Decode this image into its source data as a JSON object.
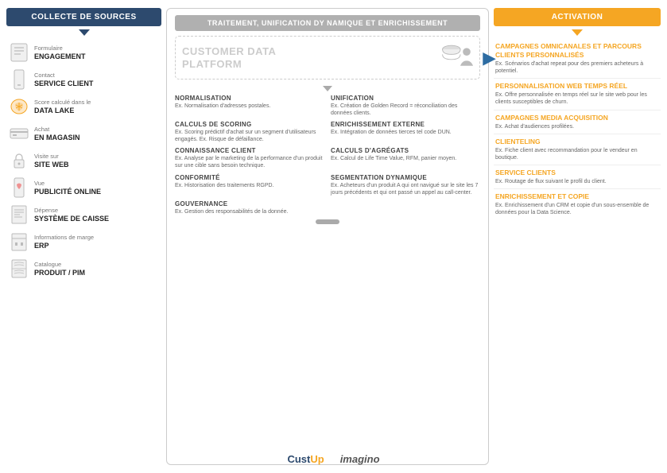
{
  "left": {
    "header": "COLLECTE DE SOURCES",
    "sources": [
      {
        "id": "engagement",
        "label": "Formulaire",
        "bold": "ENGAGEMENT",
        "icon": "form"
      },
      {
        "id": "service-client",
        "label": "Contact",
        "bold": "SERVICE CLIENT",
        "icon": "phone"
      },
      {
        "id": "data-lake",
        "label": "Score calculé dans le",
        "bold": "DATA LAKE",
        "icon": "brain"
      },
      {
        "id": "magasin",
        "label": "Achat",
        "bold": "EN MAGASIN",
        "icon": "card"
      },
      {
        "id": "site-web",
        "label": "Visite sur",
        "bold": "SITE WEB",
        "icon": "lock"
      },
      {
        "id": "publicite",
        "label": "Vue",
        "bold": "PUBLICITÉ ONLINE",
        "icon": "heart"
      },
      {
        "id": "caisse",
        "label": "Dépense",
        "bold": "SYSTÈME DE CAISSE",
        "icon": "receipt"
      },
      {
        "id": "erp",
        "label": "Informations de marge",
        "bold": "ERP",
        "icon": "building"
      },
      {
        "id": "pim",
        "label": "Catalogue",
        "bold": "PRODUIT / PIM",
        "icon": "book"
      }
    ]
  },
  "middle": {
    "header": "TRAITEMENT, UNIFICATION DY NAMIQUE ET ENRICHISSEMENT",
    "cdp_title": "CUSTOMER DATA\nPLATFORM",
    "items": [
      {
        "id": "normalisation",
        "title": "NORMALISATION",
        "desc": "Ex. Normalisation d'adresses postales."
      },
      {
        "id": "unification",
        "title": "UNIFICATION",
        "desc": "Ex. Création de Golden Record = réconciliation des données clients."
      },
      {
        "id": "calculs-scoring",
        "title": "CALCULS DE SCORING",
        "desc": "Ex. Scoring prédictif d'achat sur un segment d'utilisateurs engagés. Ex. Risque de défaillance."
      },
      {
        "id": "enrichissement-externe",
        "title": "ENRICHISSEMENT EXTERNE",
        "desc": "Ex. Intégration de données tierces tel code DUN."
      },
      {
        "id": "connaissance-client",
        "title": "CONNAISSANCE CLIENT",
        "desc": "Ex. Analyse par le marketing de la performance d'un produit sur une cible sans besoin technique."
      },
      {
        "id": "calculs-agregats",
        "title": "CALCULS D'AGRÉGATS",
        "desc": "Ex. Calcul de Life Time Value, RFM, panier moyen."
      },
      {
        "id": "conformite",
        "title": "CONFORMITÉ",
        "desc": "Ex. Historisation des traitements RGPD."
      },
      {
        "id": "segmentation",
        "title": "SEGMENTATION DYNAMIQUE",
        "desc": "Ex. Acheteurs d'un produit A qui ont navigué sur le site les 7 jours précédents et qui ont passé un appel au call-center."
      },
      {
        "id": "gouvernance",
        "title": "GOUVERNANCE",
        "desc": "Ex. Gestion des responsabilités de la donnée."
      }
    ]
  },
  "right": {
    "header": "ActivaTION",
    "items": [
      {
        "id": "campagnes-omnicanales",
        "title": "CAMPAGNES OMNICANALES ET PARCOURS CLIENTS PERSONNALISÉS",
        "desc": "Ex. Scénarios d'achat repeat pour des premiers acheteurs à potentiel."
      },
      {
        "id": "personnalisation-web",
        "title": "PERSONNALISATION WEB TEMPS RÉEL",
        "desc": "Ex. Offre personnalisée en temps réel sur le site web pour les clients susceptibles de churn."
      },
      {
        "id": "campagnes-media",
        "title": "CAMPAGNES MEDIA ACQUISITION",
        "desc": "Ex. Achat d'audiences profilées."
      },
      {
        "id": "clienteling",
        "title": "CLIENTELING",
        "desc": "Ex. Fiche client avec recommandation pour le vendeur en boutique."
      },
      {
        "id": "service-clients",
        "title": "SERVICE CLIENTS",
        "desc": "Ex. Routage de flux suivant le profil du client."
      },
      {
        "id": "enrichissement-copie",
        "title": "ENRICHISSEMENT ET COPIE",
        "desc": "Ex. Enrichissement d'un CRM et copie d'un sous-ensemble de données pour la Data Science."
      }
    ]
  },
  "footer": {
    "logo1_part1": "Cust",
    "logo1_part2": "Up",
    "logo2": "imagino"
  }
}
